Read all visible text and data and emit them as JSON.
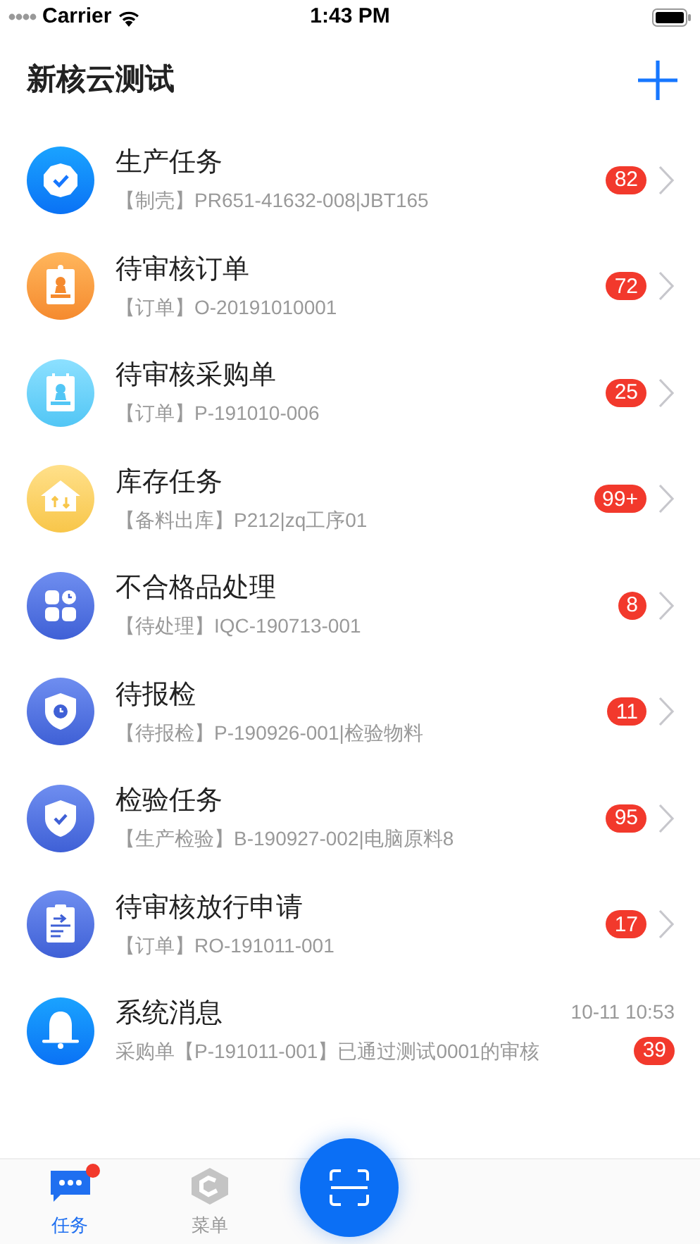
{
  "status_bar": {
    "carrier": "Carrier",
    "time": "1:43 PM"
  },
  "header": {
    "title": "新核云测试"
  },
  "items": [
    {
      "kind": "task",
      "title": "生产任务",
      "subtitle": "【制壳】PR651-41632-008|JBT165",
      "count": "82"
    },
    {
      "kind": "task",
      "title": "待审核订单",
      "subtitle": "【订单】O-20191010001",
      "count": "72"
    },
    {
      "kind": "task",
      "title": "待审核采购单",
      "subtitle": "【订单】P-191010-006",
      "count": "25"
    },
    {
      "kind": "task",
      "title": "库存任务",
      "subtitle": "【备料出库】P212|zq工序01",
      "count": "99+"
    },
    {
      "kind": "task",
      "title": "不合格品处理",
      "subtitle": "【待处理】IQC-190713-001",
      "count": "8"
    },
    {
      "kind": "task",
      "title": "待报检",
      "subtitle": "【待报检】P-190926-001|检验物料",
      "count": "11"
    },
    {
      "kind": "task",
      "title": "检验任务",
      "subtitle": "【生产检验】B-190927-002|电脑原料8",
      "count": "95"
    },
    {
      "kind": "task",
      "title": "待审核放行申请",
      "subtitle": "【订单】RO-191011-001",
      "count": "17"
    },
    {
      "kind": "message",
      "title": "系统消息",
      "subtitle": "采购单【P-191011-001】已通过测试0001的审核",
      "time": "10-11 10:53",
      "count": "39"
    }
  ],
  "tabs": [
    {
      "label": "任务",
      "selected": true,
      "dot": true
    },
    {
      "label": "菜单",
      "selected": false,
      "dot": false
    }
  ]
}
